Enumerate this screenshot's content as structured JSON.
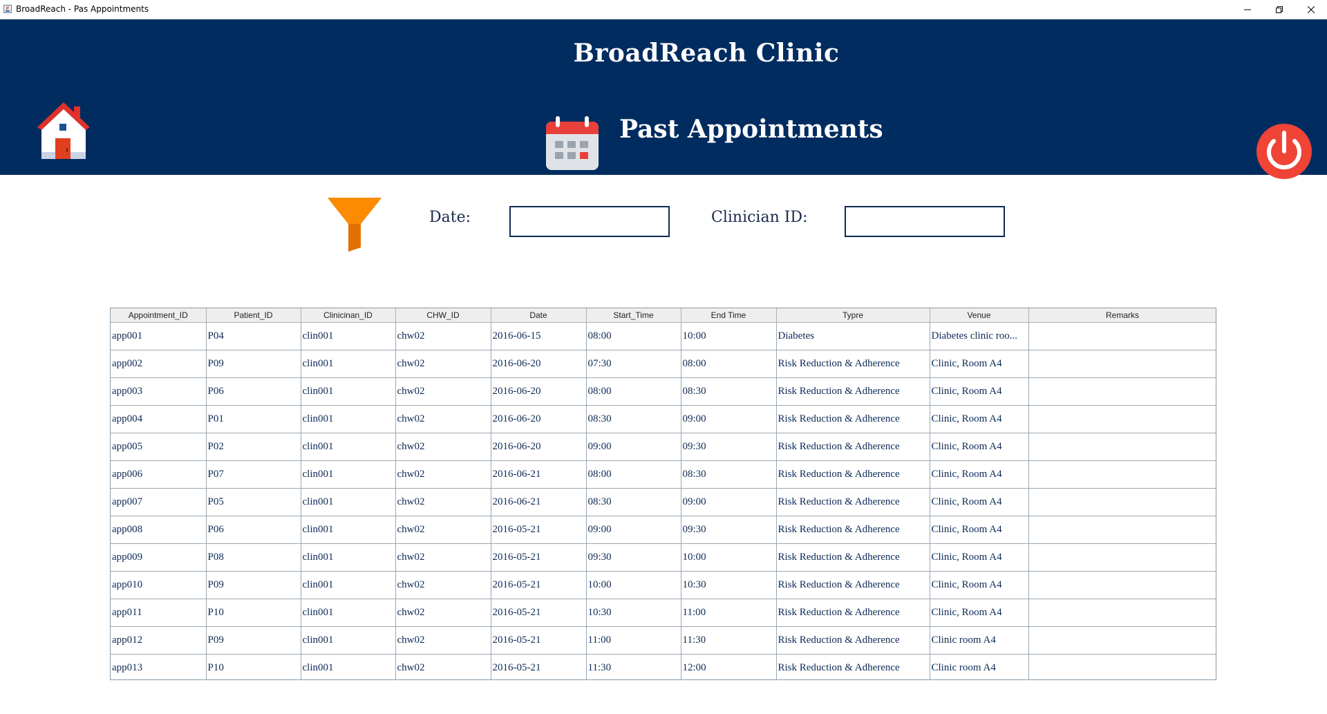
{
  "window": {
    "title": "BroadReach - Pas Appointments",
    "controls": [
      "minimize",
      "restore",
      "close"
    ]
  },
  "header": {
    "clinic_name": "BroadReach Clinic",
    "page_title": "Past Appointments",
    "background_color": "#002c5f",
    "icons": {
      "home": "home-icon",
      "calendar": "calendar-icon",
      "logout": "power-icon"
    }
  },
  "filters": {
    "icon": "filter-icon",
    "date_label": "Date:",
    "date_value": "",
    "clinician_label": "Clinician ID:",
    "clinician_value": ""
  },
  "table": {
    "columns": [
      "Appointment_ID",
      "Patient_ID",
      "Clinicinan_ID",
      "CHW_ID",
      "Date",
      "Start_Time",
      "End Time",
      "Typre",
      "Venue",
      "Remarks"
    ],
    "rows": [
      [
        "app001",
        "P04",
        "clin001",
        "chw02",
        "2016-06-15",
        "08:00",
        "10:00",
        "Diabetes",
        "Diabetes clinic roo...",
        ""
      ],
      [
        "app002",
        "P09",
        "clin001",
        "chw02",
        "2016-06-20",
        "07:30",
        "08:00",
        "Risk Reduction & Adherence",
        "Clinic, Room A4",
        ""
      ],
      [
        "app003",
        "P06",
        "clin001",
        "chw02",
        "2016-06-20",
        "08:00",
        "08:30",
        "Risk Reduction & Adherence",
        "Clinic, Room A4",
        ""
      ],
      [
        "app004",
        "P01",
        "clin001",
        "chw02",
        "2016-06-20",
        "08:30",
        "09:00",
        "Risk Reduction & Adherence",
        "Clinic, Room A4",
        ""
      ],
      [
        "app005",
        "P02",
        "clin001",
        "chw02",
        "2016-06-20",
        "09:00",
        "09:30",
        "Risk Reduction & Adherence",
        "Clinic, Room A4",
        ""
      ],
      [
        "app006",
        "P07",
        "clin001",
        "chw02",
        "2016-06-21",
        "08:00",
        "08:30",
        "Risk Reduction & Adherence",
        "Clinic, Room A4",
        ""
      ],
      [
        "app007",
        "P05",
        "clin001",
        "chw02",
        "2016-06-21",
        "08:30",
        "09:00",
        "Risk Reduction & Adherence",
        "Clinic, Room A4",
        ""
      ],
      [
        "app008",
        "P06",
        "clin001",
        "chw02",
        "2016-05-21",
        "09:00",
        "09:30",
        "Risk Reduction & Adherence",
        "Clinic, Room A4",
        ""
      ],
      [
        "app009",
        "P08",
        "clin001",
        "chw02",
        "2016-05-21",
        "09:30",
        "10:00",
        "Risk Reduction & Adherence",
        "Clinic, Room A4",
        ""
      ],
      [
        "app010",
        "P09",
        "clin001",
        "chw02",
        "2016-05-21",
        "10:00",
        "10:30",
        "Risk Reduction & Adherence",
        "Clinic, Room A4",
        ""
      ],
      [
        "app011",
        "P10",
        "clin001",
        "chw02",
        "2016-05-21",
        "10:30",
        "11:00",
        "Risk Reduction & Adherence",
        "Clinic, Room A4",
        ""
      ],
      [
        "app012",
        "P09",
        "clin001",
        "chw02",
        "2016-05-21",
        "11:00",
        "11:30",
        "Risk Reduction & Adherence",
        "Clinic room A4",
        ""
      ],
      [
        "app013",
        "P10",
        "clin001",
        "chw02",
        "2016-05-21",
        "11:30",
        "12:00",
        "Risk Reduction & Adherence",
        "Clinic room A4",
        ""
      ]
    ]
  }
}
